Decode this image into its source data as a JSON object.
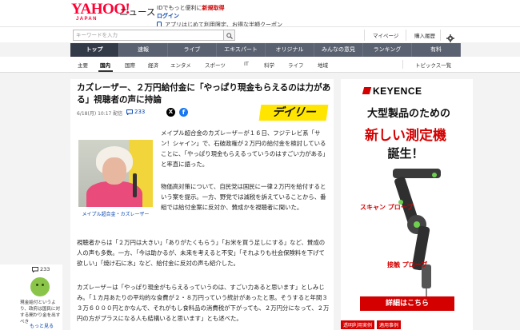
{
  "header": {
    "logo": "YAHOO!",
    "logo_sub": "JAPAN",
    "service": "ニュース",
    "msg_pre": "IDでもっと便利に",
    "msg_link": "新規取得",
    "login": "ログイン",
    "notice": "アプリはじめて利用限定、お得な半額クーポン"
  },
  "search": {
    "placeholder": "キーワードを入力",
    "mypage": "マイページ",
    "history": "購入履歴"
  },
  "main_nav": [
    "トップ",
    "速報",
    "ライブ",
    "エキスパート",
    "オリジナル",
    "みんなの意見",
    "ランキング",
    "有料"
  ],
  "sub_nav": {
    "items": [
      "主要",
      "国内",
      "国際",
      "経済",
      "エンタメ",
      "スポーツ",
      "IT",
      "科学",
      "ライフ",
      "地域"
    ],
    "topics": "トピックス一覧"
  },
  "article": {
    "title": "カズレーザー、２万円給付金に「やっぱり現金もらえるのは力がある」視聴者の声に持論",
    "date": "6/18(月) 10:17 配信",
    "comments": "233",
    "source": "デイリー",
    "photo_caption": "メイプル超合金・カズレーザー",
    "p1": "メイプル超合金のカズレーザーが１６日、フジテレビ系「サン！シャイン」で、石破政権が２万円の給付金を検討していることに、「やっぱり現金もらえるっていうのはすごい力がある」と率直に語った。",
    "p2": "物価高対策について、自民党は国民に一律２万円を給付するという案を提示。一方、野党では減税を訴えていることから、番組では給付金案に反対か、賛成かを視聴者に聞いた。",
    "p3": "視聴者からは「２万円は大きい」「ありがたくもらう」「お米を買う足しにする」など、賛成の人の声も多数。一方、「今は助かるが、未来を考えると不安」「それよりも社会保険料を下げて欲しい」「焼け石に水」など、給付金に反対の声も紹介した。",
    "p4": "カズレーザーは「やっぱり現金がもらえるっていうのは、すごい力あると思います」としみじみ。「１カ月あたりの平均的な食費が２・８万円っていう統計があったと思。そうすると年間３３万６０００円とかなんで、それがもし食料品の消費税が下がっても、２万円分になって、２万円の方がプラスになる人も結構いると思います」とも述べた。"
  },
  "ad": {
    "brand": "KEYENCE",
    "line1": "大型製品のための",
    "line2": "新しい測定機",
    "line3": "誕生！",
    "label_scan": "スキャン プローブ",
    "label_contact": "接触 プローブ",
    "button": "詳細はこちら",
    "footer_tags": [
      "透明利用実例",
      "適用事例"
    ]
  },
  "rail": {
    "count": "233",
    "text": "現金給付というより、政府は国民に対する開かり金を出すべき",
    "more": "もっと見る"
  },
  "colors": {
    "brand_red": "#ff0033",
    "nav_bg": "#5a6170",
    "nav_active": "#333a48",
    "link": "#0645ad",
    "ad_red": "#d40000",
    "daily_yellow": "#ffe500"
  }
}
